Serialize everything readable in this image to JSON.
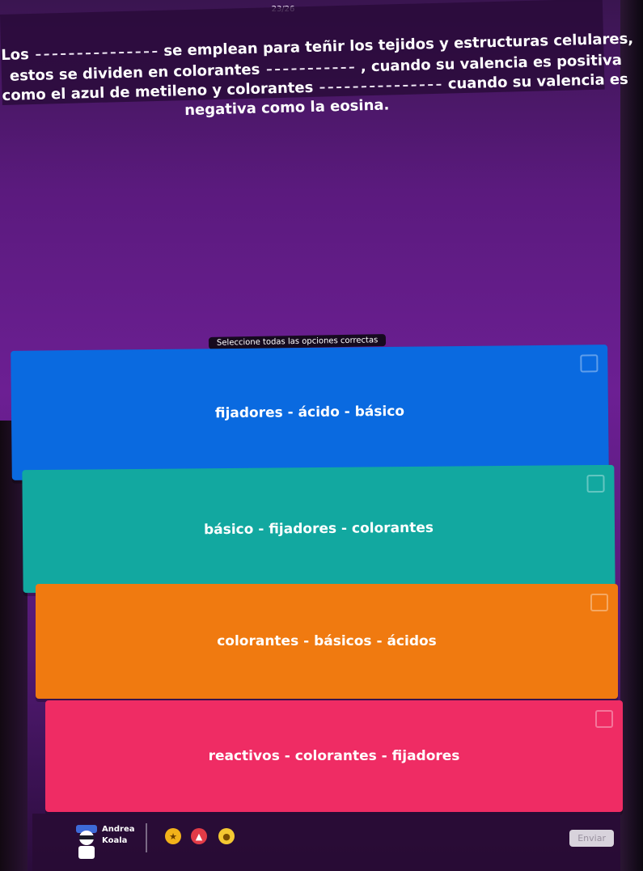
{
  "header": {
    "progress": "23/26"
  },
  "question": {
    "line1": {
      "start": "Los",
      "end": "se emplean para teñir los tejidos y estructuras celulares,"
    },
    "line2": {
      "start": "estos se dividen en colorantes",
      "end": ", cuando su valencia es positiva"
    },
    "line3": {
      "start": "como el azul de metileno y colorantes",
      "end": "cuando su valencia es"
    },
    "line4": "negativa como la eosina."
  },
  "instruction": "Seleccione todas las opciones correctas",
  "options": [
    {
      "label": "fijadores - ácido - básico",
      "color": "#0a6ae0"
    },
    {
      "label": "básico - fijadores - colorantes",
      "color": "#12a8a0"
    },
    {
      "label": "colorantes - básicos - ácidos",
      "color": "#f07a10"
    },
    {
      "label": "reactivos - colorantes - fijadores",
      "color": "#ef2c64"
    }
  ],
  "footer": {
    "player_first": "Andrea",
    "player_last": "Koala",
    "powerups": [
      "powerup-streak-icon",
      "powerup-rocket-icon",
      "powerup-coin-icon"
    ],
    "send_label": "Enviar"
  }
}
